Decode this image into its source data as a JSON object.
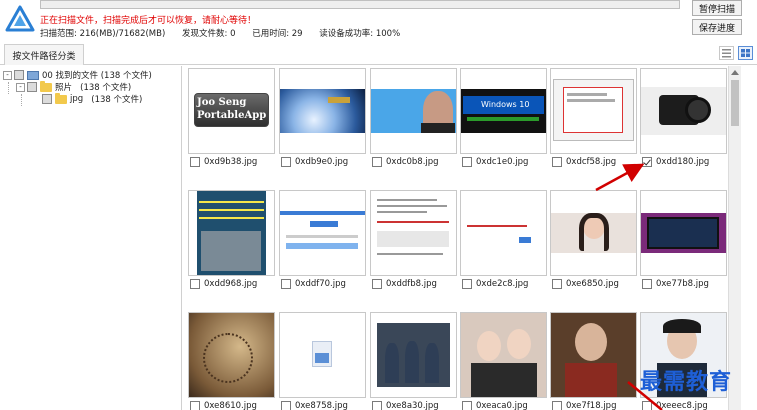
{
  "header": {
    "status_message": "正在扫描文件，扫描完成后才可以恢复，请耐心等待！",
    "scan_range": "扫描范围: 216(MB)/71682(MB)",
    "files_found": "发现文件数: 0",
    "elapsed": "已用时间: 29",
    "read_success": "读设备成功率: 100%",
    "progress_fraction": 0.0,
    "pause_button": "暂停扫描",
    "save_button": "保存进度"
  },
  "tabs": {
    "active": "按文件路径分类"
  },
  "tree": {
    "root": {
      "toggle": "-",
      "label": "00 找到的文件",
      "count": "(138 个文件)"
    },
    "child": {
      "toggle": "-",
      "label": "照片",
      "count": "(138 个文件)"
    },
    "grandchild": {
      "label": "jpg",
      "count": "(138 个文件)"
    }
  },
  "files": [
    {
      "name": "0xd9b38.jpg",
      "checked": false,
      "thumb": "joo-seng",
      "overlay": [
        "Joo Seng",
        "PortableApp"
      ]
    },
    {
      "name": "0xdb9e0.jpg",
      "checked": false,
      "thumb": "satellite"
    },
    {
      "name": "0xdc0b8.jpg",
      "checked": false,
      "thumb": "portrait-twitter"
    },
    {
      "name": "0xdc1e0.jpg",
      "checked": false,
      "thumb": "windows10",
      "overlay": [
        "Windows 10"
      ]
    },
    {
      "name": "0xdcf58.jpg",
      "checked": false,
      "thumb": "dialog"
    },
    {
      "name": "0xdd180.jpg",
      "checked": true,
      "thumb": "camera"
    },
    {
      "name": "0xdd968.jpg",
      "checked": false,
      "thumb": "poster"
    },
    {
      "name": "0xddf70.jpg",
      "checked": false,
      "thumb": "webpage"
    },
    {
      "name": "0xddfb8.jpg",
      "checked": false,
      "thumb": "document"
    },
    {
      "name": "0xde2c8.jpg",
      "checked": false,
      "thumb": "blank-ui"
    },
    {
      "name": "0xe6850.jpg",
      "checked": false,
      "thumb": "woman"
    },
    {
      "name": "0xe77b8.jpg",
      "checked": false,
      "thumb": "monitor"
    },
    {
      "name": "0xe8610.jpg",
      "checked": false,
      "thumb": "map"
    },
    {
      "name": "0xe8758.jpg",
      "checked": false,
      "thumb": "file-icon"
    },
    {
      "name": "0xe8a30.jpg",
      "checked": false,
      "thumb": "astronauts"
    },
    {
      "name": "0xeaca0.jpg",
      "checked": false,
      "thumb": "selfie"
    },
    {
      "name": "0xe7f18.jpg",
      "checked": false,
      "thumb": "oldman"
    },
    {
      "name": "0xeeec8.jpg",
      "checked": false,
      "thumb": "actor"
    }
  ],
  "watermark": "最需教育",
  "colors": {
    "status_red": "#e00000",
    "accent_blue": "#1e5fd6",
    "annotation_red": "#d10000"
  }
}
